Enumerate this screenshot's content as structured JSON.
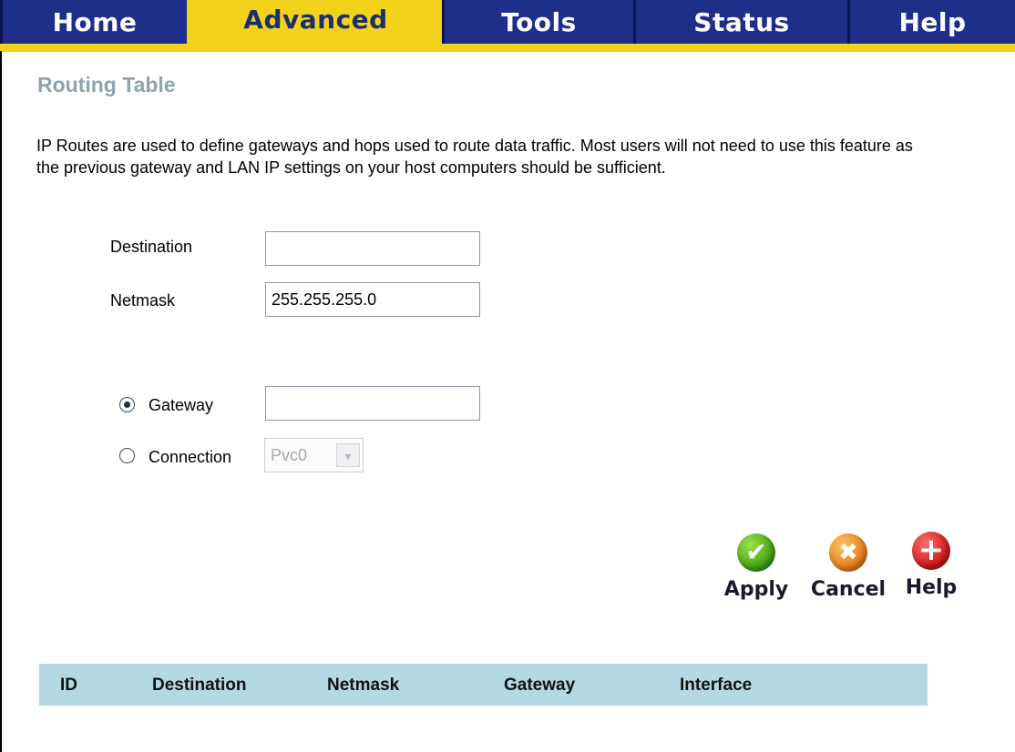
{
  "nav": {
    "tabs": [
      {
        "label": "Home",
        "active": false
      },
      {
        "label": "Advanced",
        "active": true
      },
      {
        "label": "Tools",
        "active": false
      },
      {
        "label": "Status",
        "active": false
      },
      {
        "label": "Help",
        "active": false
      }
    ]
  },
  "page": {
    "title": "Routing Table",
    "description": "IP Routes are used to define gateways and hops used to route data traffic. Most users will not need to use this feature as the previous gateway and LAN IP settings on your host computers should be sufficient."
  },
  "form": {
    "destination": {
      "label": "Destination",
      "value": ""
    },
    "netmask": {
      "label": "Netmask",
      "value": "255.255.255.0"
    },
    "gateway": {
      "label": "Gateway",
      "value": "",
      "selected": true
    },
    "connection": {
      "label": "Connection",
      "value": "Pvc0",
      "selected": false,
      "disabled": true
    }
  },
  "actions": {
    "apply": "Apply",
    "cancel": "Cancel",
    "help": "Help"
  },
  "table": {
    "headers": [
      "ID",
      "Destination",
      "Netmask",
      "Gateway",
      "Interface"
    ],
    "rows": []
  },
  "colors": {
    "tab_bg": "#1d2f88",
    "tab_active_bg": "#f3d21c",
    "title": "#8ea3ad",
    "table_header_bg": "#b5d8e5"
  }
}
